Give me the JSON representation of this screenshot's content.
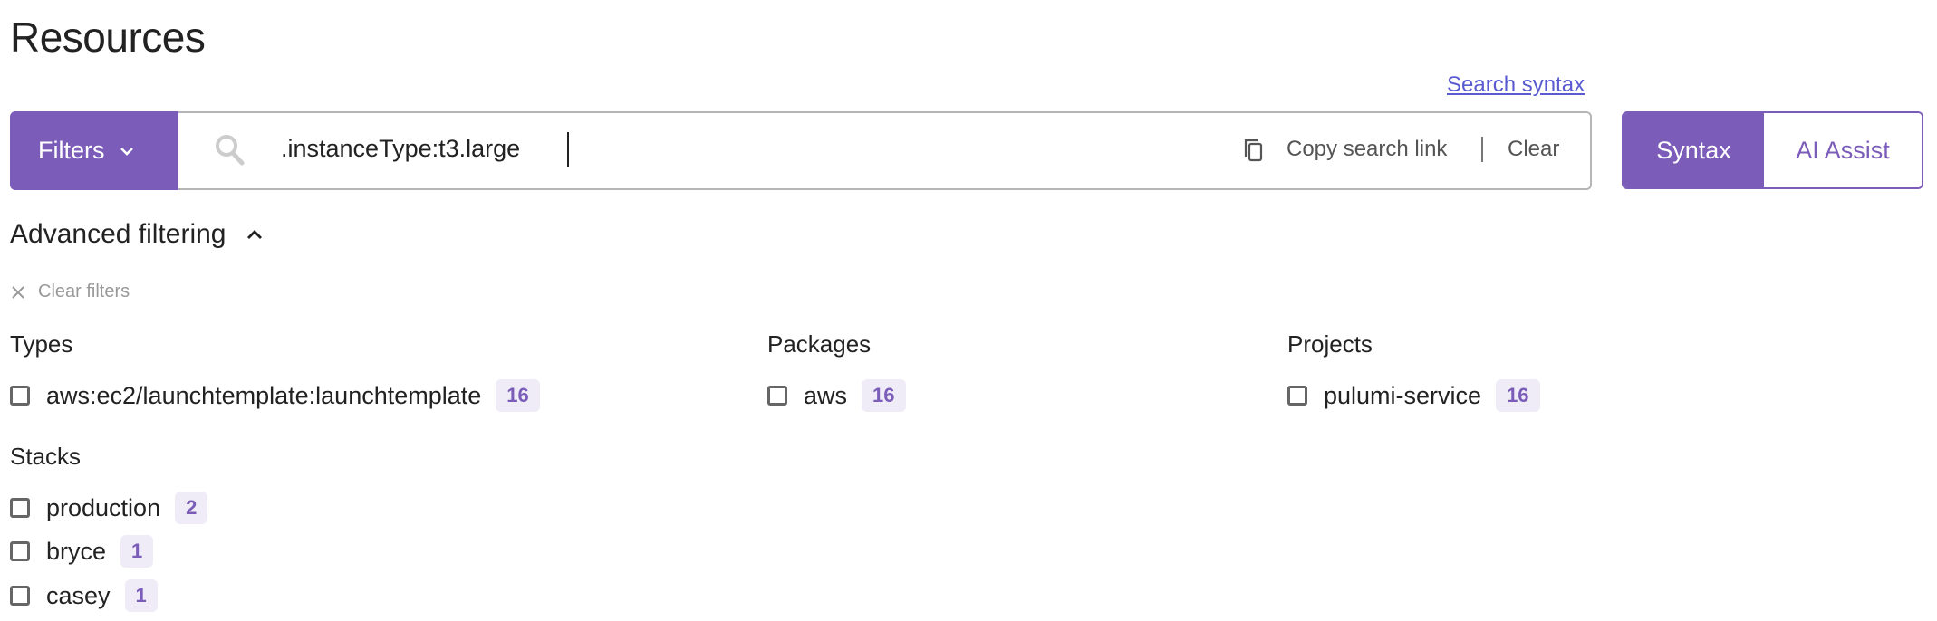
{
  "page_title": "Resources",
  "search_syntax_link": "Search syntax",
  "filters_button": "Filters",
  "search": {
    "value": ".instanceType:t3.large",
    "copy_link": "Copy search link",
    "clear": "Clear"
  },
  "mode": {
    "syntax": "Syntax",
    "ai_assist": "AI Assist",
    "selected": "Syntax"
  },
  "advanced_filtering": "Advanced filtering",
  "clear_filters": "Clear filters",
  "groups": {
    "types": {
      "title": "Types",
      "items": [
        {
          "label": "aws:ec2/launchtemplate:launchtemplate",
          "count": "16"
        }
      ]
    },
    "packages": {
      "title": "Packages",
      "items": [
        {
          "label": "aws",
          "count": "16"
        }
      ]
    },
    "projects": {
      "title": "Projects",
      "items": [
        {
          "label": "pulumi-service",
          "count": "16"
        }
      ]
    },
    "stacks": {
      "title": "Stacks",
      "items": [
        {
          "label": "production",
          "count": "2"
        },
        {
          "label": "bryce",
          "count": "1"
        },
        {
          "label": "casey",
          "count": "1"
        }
      ]
    }
  },
  "colors": {
    "accent": "#7b5cb9",
    "badge_bg": "#efecf8",
    "link": "#5a5bd0"
  }
}
